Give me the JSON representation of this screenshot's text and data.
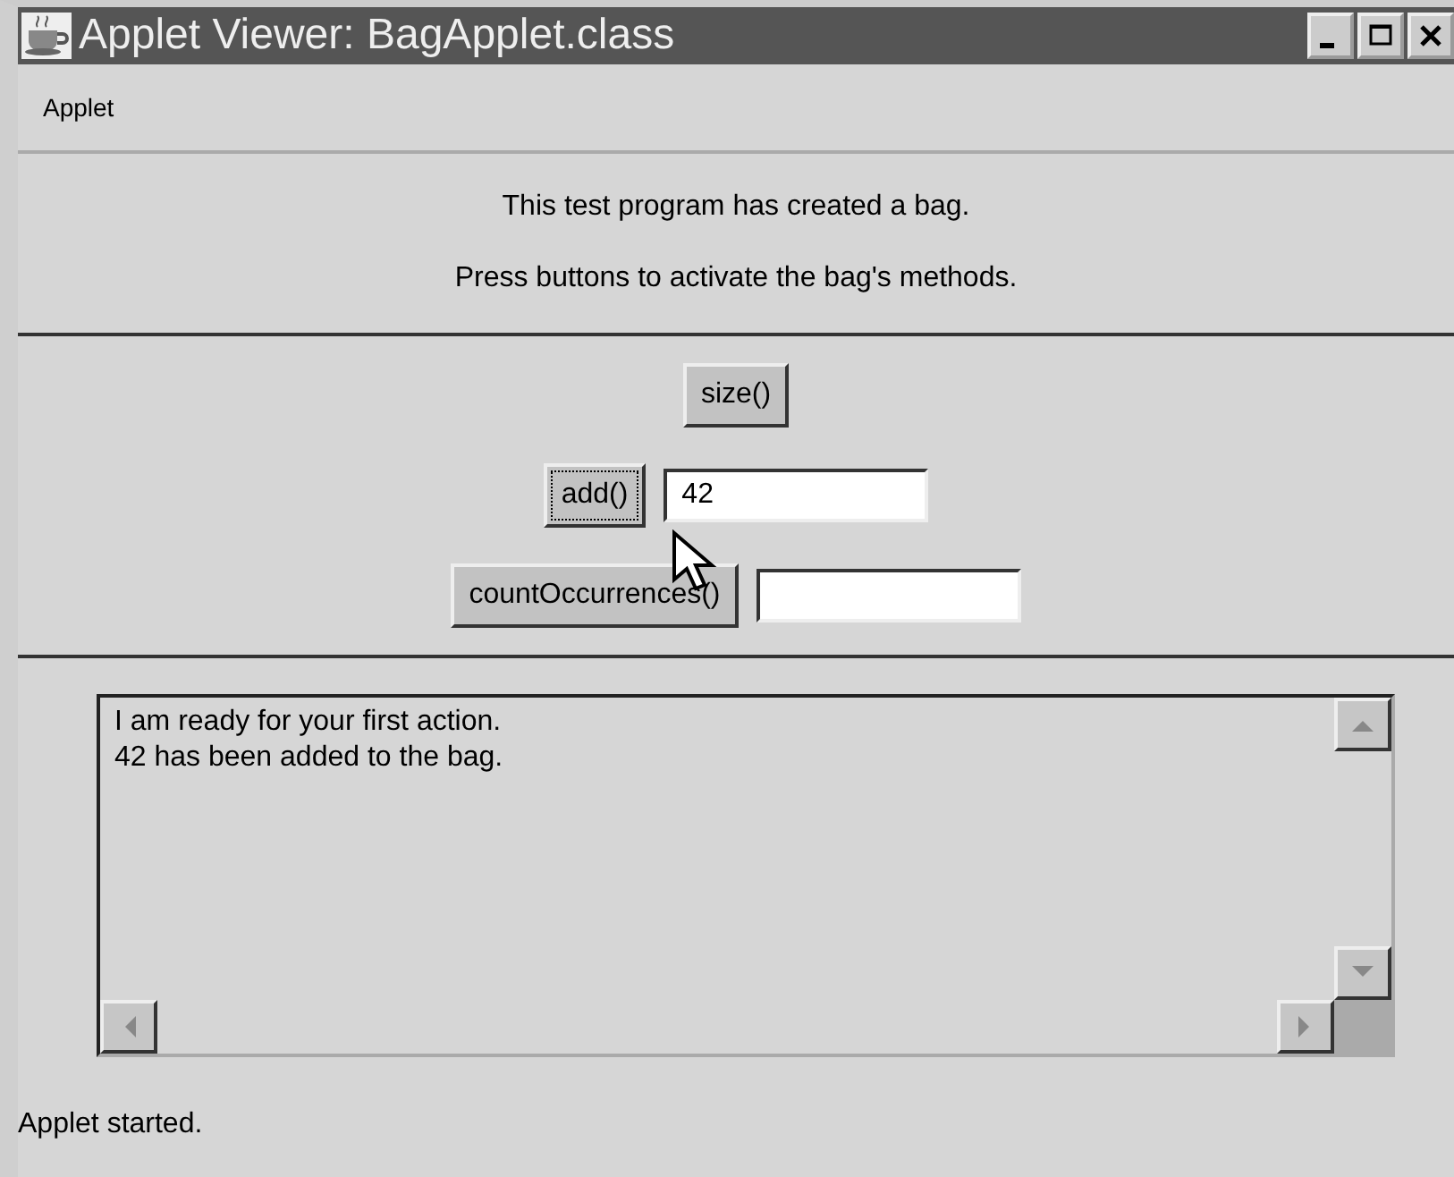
{
  "window": {
    "title": "Applet Viewer: BagApplet.class"
  },
  "menu": [
    "Applet"
  ],
  "messages": [
    "This test program has created a bag.",
    "Press buttons to activate the bag's methods."
  ],
  "controls": [
    {
      "kind": "button",
      "label": "size()",
      "focused": false
    },
    {
      "kind": "button-field",
      "label": "add()",
      "focused": true,
      "value": "42"
    },
    {
      "kind": "button-field",
      "label": "countOccurrences()",
      "focused": false
    }
  ],
  "output": {
    "lines": [
      "I am ready for your first action.",
      "42 has been added to the bag."
    ]
  },
  "status_bar": "Applet started."
}
